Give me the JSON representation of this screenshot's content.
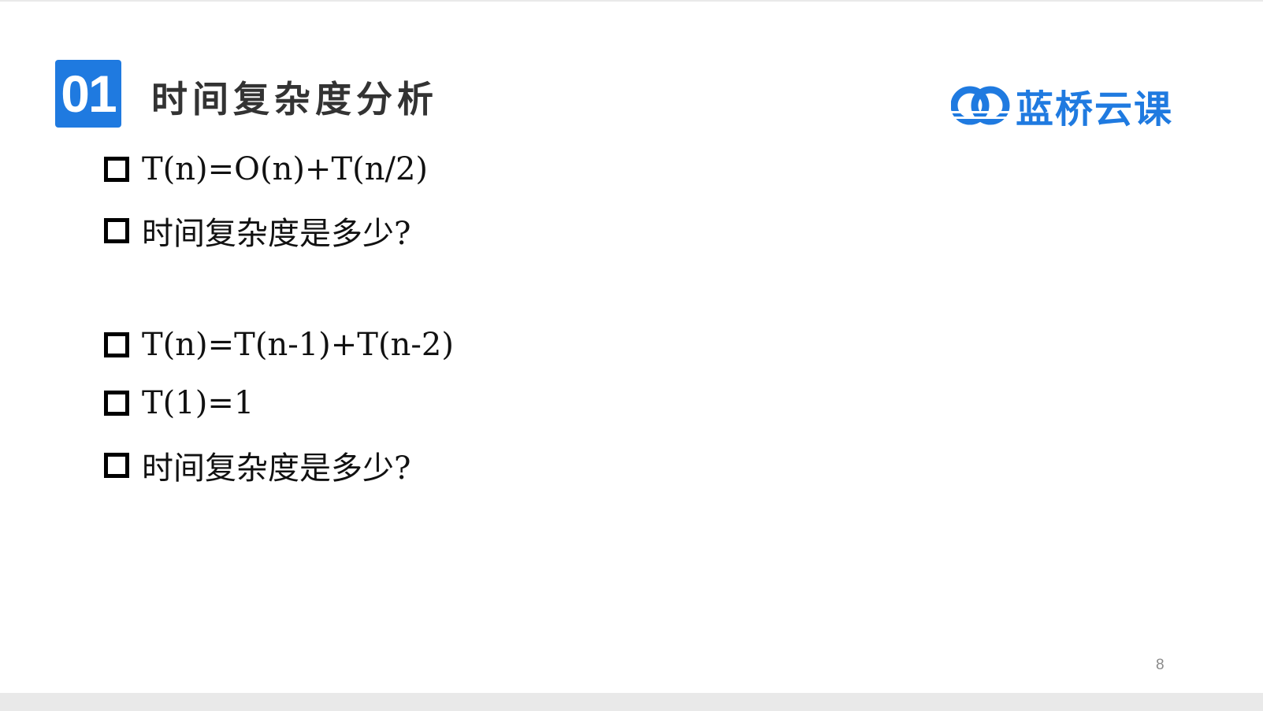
{
  "slide": {
    "section_number": "01",
    "title": "时间复杂度分析",
    "logo_text": "蓝桥云课",
    "logo_icon": "lanqiao-logo-icon",
    "accent_color": "#1f7ae0",
    "page_number": "8"
  },
  "bullets": [
    {
      "text": "T(n)=O(n)+T(n/2)"
    },
    {
      "text": "时间复杂度是多少?"
    },
    {
      "text": "T(n)=T(n-1)+T(n-2)"
    },
    {
      "text": "T(1)=1"
    },
    {
      "text": "时间复杂度是多少?"
    }
  ]
}
